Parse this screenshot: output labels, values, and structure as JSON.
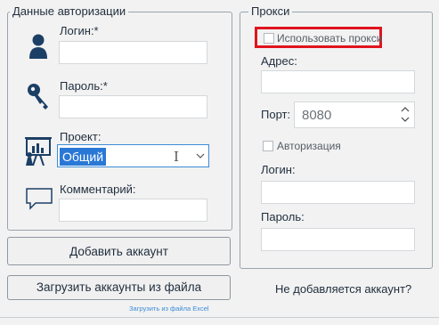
{
  "auth": {
    "title": "Данные авторизации",
    "login_label": "Логин:*",
    "password_label": "Пароль:*",
    "project_label": "Проект:",
    "project_value": "Общий",
    "comment_label": "Комментарий:"
  },
  "proxy": {
    "title": "Прокси",
    "use_proxy_label": "Использовать прокси",
    "address_label": "Адрес:",
    "port_label": "Порт:",
    "port_value": "8080",
    "auth_label": "Авторизация",
    "login_label": "Логин:",
    "password_label": "Пароль:"
  },
  "buttons": {
    "add_account": "Добавить аккаунт",
    "load_from_file": "Загрузить аккаунты из файла",
    "load_from_excel": "Загрузить из файла Excel",
    "help_link": "Не добавляется аккаунт?"
  },
  "colors": {
    "accent": "#2a78d6",
    "highlight_border": "#e0141e",
    "link": "#3a8bd8"
  }
}
